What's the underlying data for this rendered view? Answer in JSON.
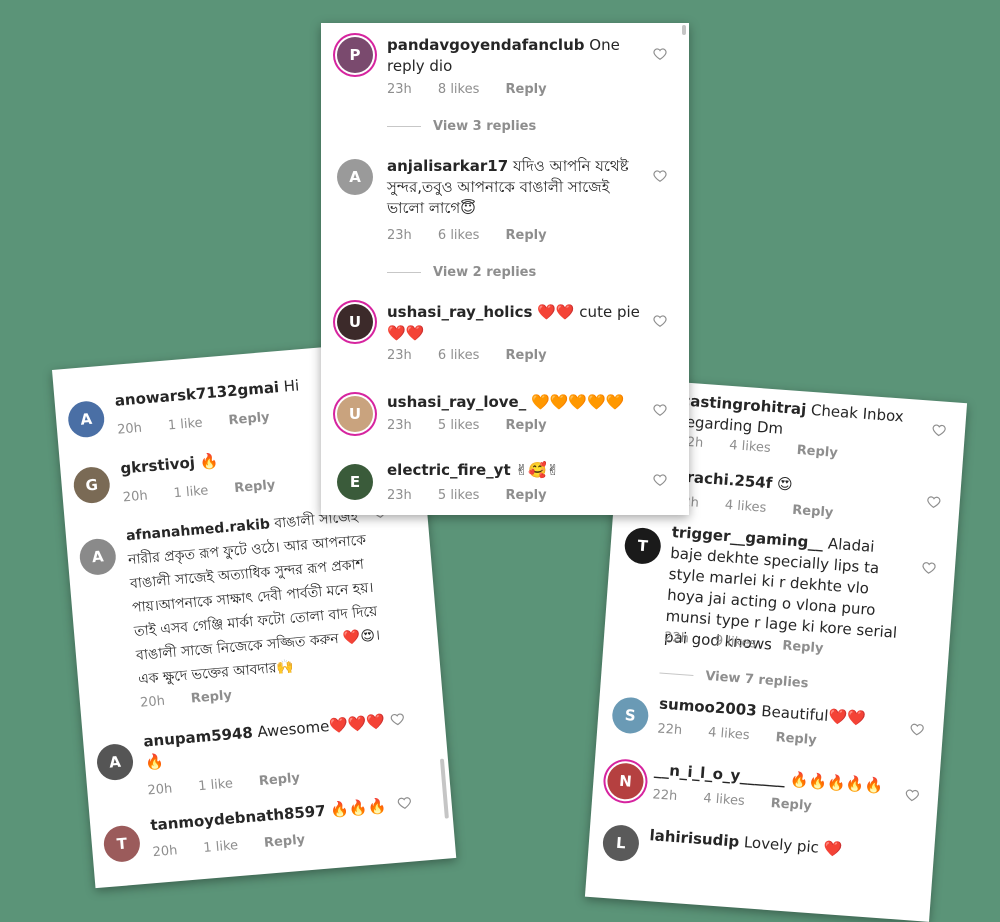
{
  "center_comments": [
    {
      "user": "pandavgoyendafanclub",
      "text": "One reply dio",
      "time": "23h",
      "likes": "8 likes",
      "reply": "Reply",
      "view_replies": "View 3 replies",
      "avatar_color": "#7a4a6e"
    },
    {
      "user": "anjalisarkar17",
      "text": "যদিও আপনি যথেষ্ট সুন্দর,তবুও আপনাকে বাঙালী সাজেই ভালো লাগে😇",
      "time": "23h",
      "likes": "6 likes",
      "reply": "Reply",
      "view_replies": "View 2 replies",
      "avatar_color": "#9a9a9a"
    },
    {
      "user": "ushasi_ray_holics",
      "text": "❤️❤️ cute pie ❤️❤️",
      "time": "23h",
      "likes": "6 likes",
      "reply": "Reply",
      "avatar_color": "#3c2a2a"
    },
    {
      "user": "ushasi_ray_love_",
      "text": "🧡🧡🧡🧡🧡",
      "time": "23h",
      "likes": "5 likes",
      "reply": "Reply",
      "avatar_color": "#c9a37e"
    },
    {
      "user": "electric_fire_yt",
      "text": "✌🥰✌",
      "time": "23h",
      "likes": "5 likes",
      "reply": "Reply",
      "avatar_color": "#3a5b3a"
    }
  ],
  "left_comments": [
    {
      "user": "anowarsk7132gmai",
      "text": "Hi",
      "time": "20h",
      "likes": "1 like",
      "reply": "Reply",
      "avatar_color": "#4a6fa5"
    },
    {
      "user": "gkrstivoj",
      "text": "🔥",
      "time": "20h",
      "likes": "1 like",
      "reply": "Reply",
      "avatar_color": "#7a6a55"
    },
    {
      "user": "afnanahmed.rakib",
      "text": "বাঙালী সাজেই নারীর প্রকৃত রূপ ফুটে ওঠে। আর আপনাকে বাঙালী সাজেই অত্যাধিক সুন্দর রূপ প্রকাশ পায়।আপনাকে সাক্ষাৎ দেবী পার্বতী মনে হয়। তাই এসব গেঞ্জি মার্কা ফটো তোলা বাদ দিয়ে বাঙালী সাজে নিজেকে সজ্জিত করুন ❤️😍।এক ক্ষুদে ভক্তের আবদার🙌",
      "time": "20h",
      "reply": "Reply",
      "avatar_color": "#8a8a8a"
    },
    {
      "user": "anupam5948",
      "text": "Awesome❤️❤️❤️🔥",
      "time": "20h",
      "likes": "1 like",
      "reply": "Reply",
      "avatar_color": "#555555"
    },
    {
      "user": "tanmoydebnath8597",
      "text": "🔥🔥🔥",
      "time": "20h",
      "likes": "1 like",
      "reply": "Reply",
      "avatar_color": "#9b5b5b"
    }
  ],
  "right_comments": [
    {
      "user": "castingrohitraj",
      "text": "Cheak Inbox regarding Dm",
      "time": "22h",
      "likes": "4 likes",
      "reply": "Reply",
      "avatar_color": "#444444"
    },
    {
      "user": "prachi.254f",
      "text": "😍",
      "time": "22h",
      "likes": "4 likes",
      "reply": "Reply",
      "avatar_color": "#b07a8a"
    },
    {
      "user": "trigger__gaming__",
      "text": "Aladai baje dekhte specially lips ta style marlei ki r dekhte vlo hoya jai acting o vlona puro munsi type r lage ki kore serial pai god knows",
      "time": "22h",
      "likes": "9 likes",
      "reply": "Reply",
      "view_replies": "View 7 replies",
      "avatar_color": "#1a1a1a"
    },
    {
      "user": "sumoo2003",
      "text": "Beautiful❤️❤️",
      "time": "22h",
      "likes": "4 likes",
      "reply": "Reply",
      "avatar_color": "#6a9ab5"
    },
    {
      "user": "__n_i_l_o_y______",
      "text": "🔥🔥🔥🔥🔥",
      "time": "22h",
      "likes": "4 likes",
      "reply": "Reply",
      "avatar_color": "#b54040"
    },
    {
      "user": "lahirisudip",
      "text": "Lovely pic ❤️",
      "avatar_color": "#5a5a5a"
    }
  ],
  "colors": {
    "background": "#5b9478",
    "text": "#262626",
    "meta": "#8e8e8e"
  }
}
